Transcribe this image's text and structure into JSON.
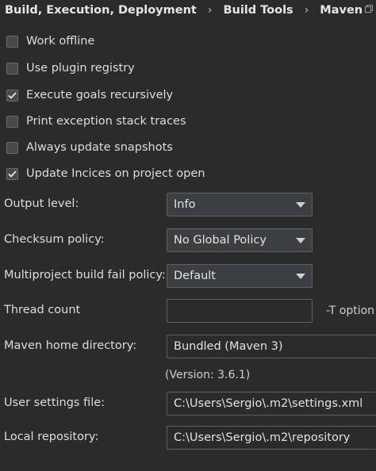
{
  "breadcrumb": {
    "items": [
      "Build, Execution, Deployment",
      "Build Tools",
      "Maven"
    ],
    "separator": "›"
  },
  "checkboxes": [
    {
      "label": "Work offline",
      "checked": false
    },
    {
      "label": "Use plugin registry",
      "checked": false
    },
    {
      "label": "Execute goals recursively",
      "checked": true
    },
    {
      "label": "Print exception stack traces",
      "checked": false
    },
    {
      "label": "Always update snapshots",
      "checked": false
    },
    {
      "label": "Update Incices on project open",
      "checked": true
    }
  ],
  "output_level": {
    "label": "Output level:",
    "value": "Info"
  },
  "checksum_policy": {
    "label": "Checksum policy:",
    "value": "No Global Policy"
  },
  "multiproject_fail_policy": {
    "label": "Multiproject build fail policy:",
    "value": "Default"
  },
  "thread_count": {
    "label": "Thread count",
    "value": "",
    "hint": "-T option"
  },
  "maven_home": {
    "label": "Maven home directory:",
    "value": "Bundled (Maven 3)",
    "version": "(Version: 3.6.1)"
  },
  "user_settings": {
    "label": "User settings file:",
    "value": "C:\\Users\\Sergio\\.m2\\settings.xml"
  },
  "local_repository": {
    "label": "Local repository:",
    "value": "C:\\Users\\Sergio\\.m2\\repository"
  },
  "colors": {
    "background": "#2b2b2b",
    "field_background": "#3c3f41",
    "border": "#5e6163",
    "text": "#dddddd"
  }
}
